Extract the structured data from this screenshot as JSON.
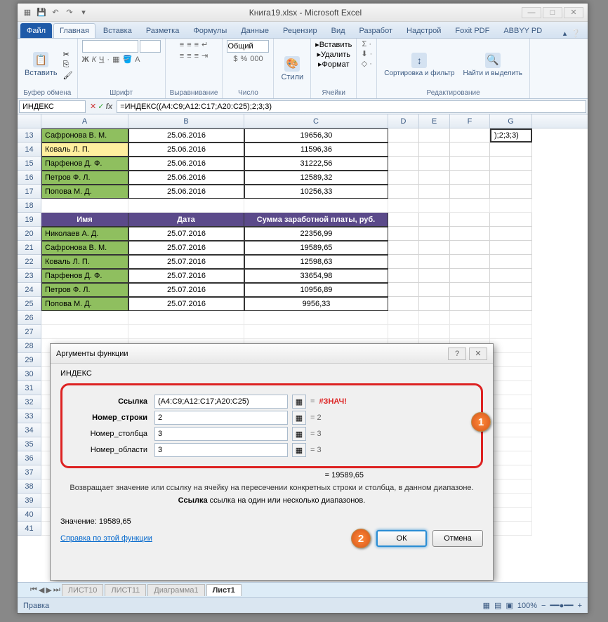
{
  "window": {
    "title": "Книга19.xlsx - Microsoft Excel"
  },
  "qat": {
    "save": "💾",
    "undo": "↶",
    "redo": "↷"
  },
  "tabs": {
    "file": "Файл",
    "home": "Главная",
    "insert": "Вставка",
    "layout": "Разметка",
    "formulas": "Формулы",
    "data": "Данные",
    "review": "Рецензир",
    "view": "Вид",
    "dev": "Разработ",
    "addins": "Надстрой",
    "foxit": "Foxit PDF",
    "abbyy": "ABBYY PD"
  },
  "ribbon": {
    "paste": "Вставить",
    "clipboard": "Буфер обмена",
    "font": "Шрифт",
    "align": "Выравнивание",
    "numfmt": "Общий",
    "number": "Число",
    "styles": "Стили",
    "insert": "Вставить",
    "delete": "Удалить",
    "format": "Формат",
    "cells": "Ячейки",
    "sort": "Сортировка и фильтр",
    "find": "Найти и выделить",
    "editing": "Редактирование"
  },
  "namebox": "ИНДЕКС",
  "formula": "=ИНДЕКС((A4:C9;A12:C17;A20:C25);2;3;3)",
  "cols": {
    "A": "A",
    "B": "B",
    "C": "C",
    "D": "D",
    "E": "E",
    "F": "F",
    "G": "G"
  },
  "rows1": [
    {
      "n": "13",
      "a": "Сафронова В. М.",
      "b": "25.06.2016",
      "c": "19656,30"
    },
    {
      "n": "14",
      "a": "Коваль Л. П.",
      "b": "25.06.2016",
      "c": "11596,36",
      "sel": true
    },
    {
      "n": "15",
      "a": "Парфенов Д. Ф.",
      "b": "25.06.2016",
      "c": "31222,56"
    },
    {
      "n": "16",
      "a": "Петров Ф. Л.",
      "b": "25.06.2016",
      "c": "12589,32"
    },
    {
      "n": "17",
      "a": "Попова М. Д.",
      "b": "25.06.2016",
      "c": "10256,33"
    }
  ],
  "header": {
    "a": "Имя",
    "b": "Дата",
    "c": "Сумма заработной платы, руб."
  },
  "rows2": [
    {
      "n": "20",
      "a": "Николаев А. Д.",
      "b": "25.07.2016",
      "c": "22356,99"
    },
    {
      "n": "21",
      "a": "Сафронова В. М.",
      "b": "25.07.2016",
      "c": "19589,65"
    },
    {
      "n": "22",
      "a": "Коваль Л. П.",
      "b": "25.07.2016",
      "c": "12598,63"
    },
    {
      "n": "23",
      "a": "Парфенов Д. Ф.",
      "b": "25.07.2016",
      "c": "33654,98"
    },
    {
      "n": "24",
      "a": "Петров Ф. Л.",
      "b": "25.07.2016",
      "c": "10956,89"
    },
    {
      "n": "25",
      "a": "Попова М. Д.",
      "b": "25.07.2016",
      "c": "9956,33"
    }
  ],
  "activecell": ");2;3;3)",
  "emptyrows": [
    "18",
    "26",
    "27",
    "28",
    "29",
    "30",
    "31",
    "32",
    "33",
    "34",
    "35",
    "36",
    "37",
    "38",
    "39",
    "40",
    "41"
  ],
  "dialog": {
    "title": "Аргументы функции",
    "func": "ИНДЕКС",
    "args": {
      "ref_label": "Ссылка",
      "ref_val": "(A4:C9;A12:C17;A20:C25)",
      "ref_res": "#ЗНАЧ!",
      "row_label": "Номер_строки",
      "row_val": "2",
      "row_res": "2",
      "col_label": "Номер_столбца",
      "col_val": "3",
      "col_res": "3",
      "area_label": "Номер_области",
      "area_val": "3",
      "area_res": "3"
    },
    "result_eq": "= 19589,65",
    "desc": "Возвращает значение или ссылку на ячейку на пересечении конкретных строки и столбца, в данном диапазоне.",
    "desc2_label": "Ссылка",
    "desc2_text": "ссылка на один или несколько диапазонов.",
    "value_label": "Значение:",
    "value": "19589,65",
    "help": "Справка по этой функции",
    "ok": "ОК",
    "cancel": "Отмена"
  },
  "sheets": {
    "s1": "ЛИСТ10",
    "s2": "ЛИСТ11",
    "s3": "Диаграмма1",
    "act": "Лист1"
  },
  "status": {
    "mode": "Правка",
    "zoom": "100%"
  }
}
